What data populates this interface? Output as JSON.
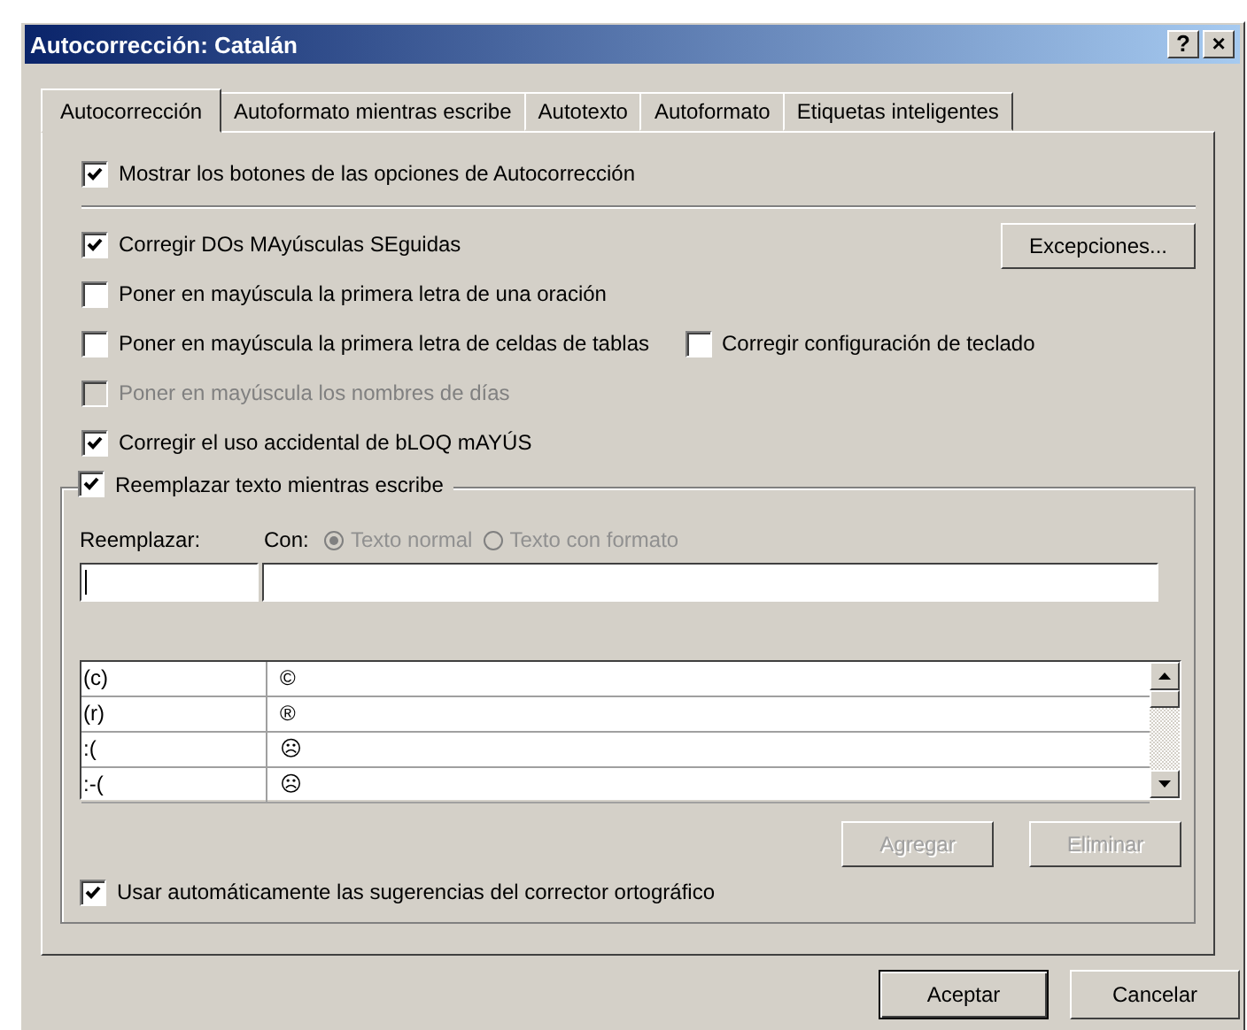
{
  "window": {
    "title": "Autocorrección: Catalán",
    "help_button": "?",
    "close_button": "×"
  },
  "tabs": [
    {
      "label": "Autocorrección",
      "selected": true
    },
    {
      "label": "Autoformato mientras escribe",
      "selected": false
    },
    {
      "label": "Autotexto",
      "selected": false
    },
    {
      "label": "Autoformato",
      "selected": false
    },
    {
      "label": "Etiquetas inteligentes",
      "selected": false
    }
  ],
  "show_buttons": {
    "label": "Mostrar los botones de las opciones de Autocorrección",
    "checked": true,
    "disabled": false
  },
  "exceptions_button": "Excepciones...",
  "option_rows": [
    [
      {
        "label": "Corregir DOs MAyúsculas SEguidas",
        "checked": true,
        "disabled": false
      }
    ],
    [
      {
        "label": "Poner en mayúscula la primera letra de una oración",
        "checked": false,
        "disabled": false
      }
    ],
    [
      {
        "label": "Poner en mayúscula la primera letra de celdas de tablas",
        "checked": false,
        "disabled": false
      },
      {
        "label": "Corregir configuración de teclado",
        "checked": false,
        "disabled": false
      }
    ],
    [
      {
        "label": "Poner en mayúscula los nombres de días",
        "checked": false,
        "disabled": true
      }
    ],
    [
      {
        "label": "Corregir el uso accidental de bLOQ mAYÚS",
        "checked": true,
        "disabled": false
      }
    ]
  ],
  "replace_group": {
    "label": "Reemplazar texto mientras escribe",
    "checked": true,
    "replace_label": "Reemplazar:",
    "with_label": "Con:",
    "format_options": [
      {
        "label": "Texto normal",
        "selected": true,
        "disabled": true
      },
      {
        "label": "Texto con formato",
        "selected": false,
        "disabled": true
      }
    ],
    "entries": [
      {
        "replace": "(c)",
        "with": "©"
      },
      {
        "replace": "(r)",
        "with": "®"
      },
      {
        "replace": ":(",
        "with": "☹"
      },
      {
        "replace": ":-(",
        "with": "☹"
      }
    ],
    "buttons": [
      {
        "label": "Agregar",
        "disabled": true
      },
      {
        "label": "Eliminar",
        "disabled": true
      }
    ],
    "spelling": {
      "label": "Usar automáticamente las sugerencias del corrector ortográfico",
      "checked": true,
      "disabled": false
    }
  },
  "footer_buttons": [
    {
      "label": "Aceptar",
      "default": true
    },
    {
      "label": "Cancelar",
      "default": false
    }
  ]
}
